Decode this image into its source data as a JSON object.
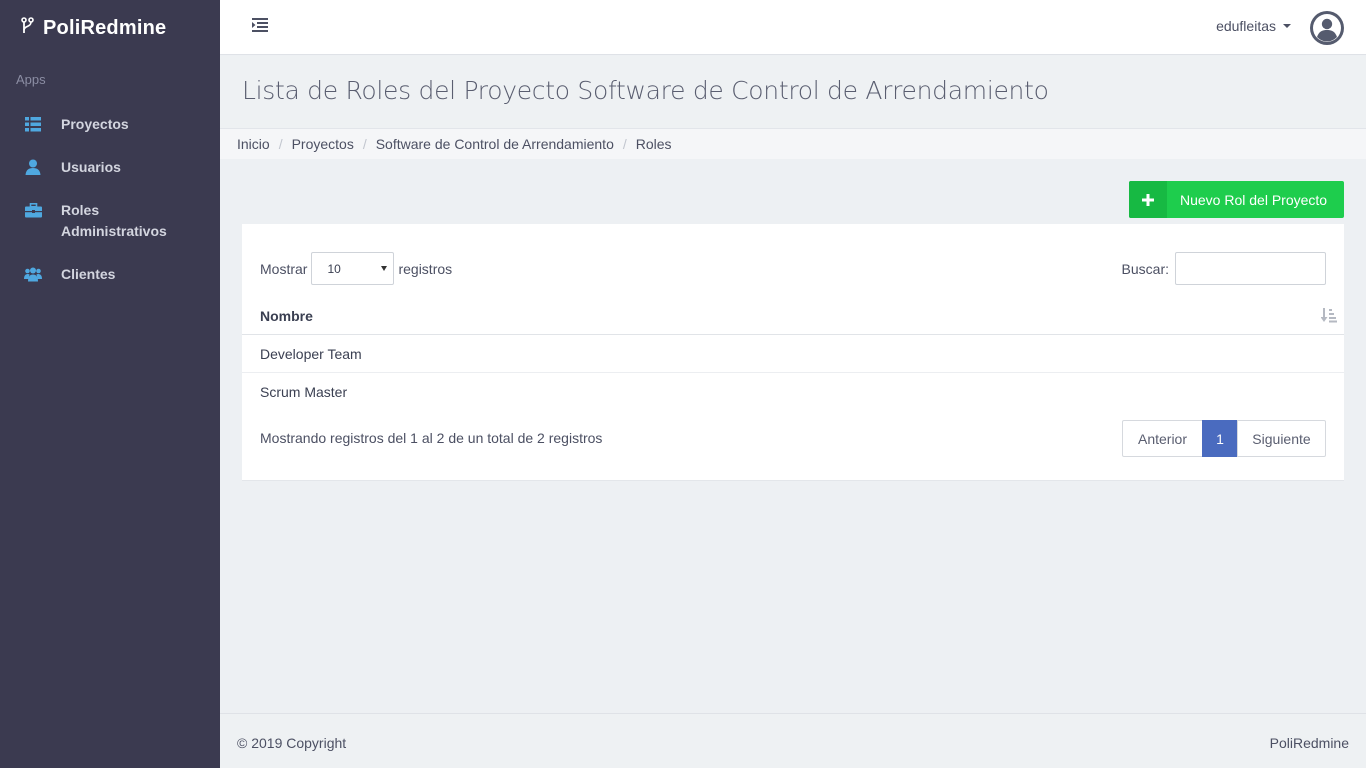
{
  "app": {
    "name": "PoliRedmine"
  },
  "sidebar": {
    "section_label": "Apps",
    "items": [
      {
        "label": "Proyectos",
        "icon": "list-icon"
      },
      {
        "label": "Usuarios",
        "icon": "user-icon"
      },
      {
        "label": "Roles Administrativos",
        "icon": "briefcase-icon"
      },
      {
        "label": "Clientes",
        "icon": "users-group-icon"
      }
    ]
  },
  "topbar": {
    "username": "edufleitas"
  },
  "page": {
    "title": "Lista de Roles del Proyecto Software de Control de Arrendamiento"
  },
  "breadcrumb": [
    "Inicio",
    "Proyectos",
    "Software de Control de Arrendamiento",
    "Roles"
  ],
  "toolbar": {
    "new_button_label": "Nuevo Rol del Proyecto"
  },
  "table": {
    "length_prefix": "Mostrar",
    "length_value": "10",
    "length_suffix": "registros",
    "search_label": "Buscar:",
    "search_value": "",
    "column_header": "Nombre",
    "rows": [
      "Developer Team",
      "Scrum Master"
    ],
    "info": "Mostrando registros del 1 al 2 de un total de 2 registros"
  },
  "pagination": {
    "prev": "Anterior",
    "current": "1",
    "next": "Siguiente"
  },
  "footer": {
    "copyright": "© 2019 Copyright",
    "brand": "PoliRedmine"
  },
  "colors": {
    "sidebar_bg": "#3b3a50",
    "accent_green": "#1ecd4d",
    "page_active": "#4a6bbf",
    "icon_blue": "#4fa8e0"
  }
}
